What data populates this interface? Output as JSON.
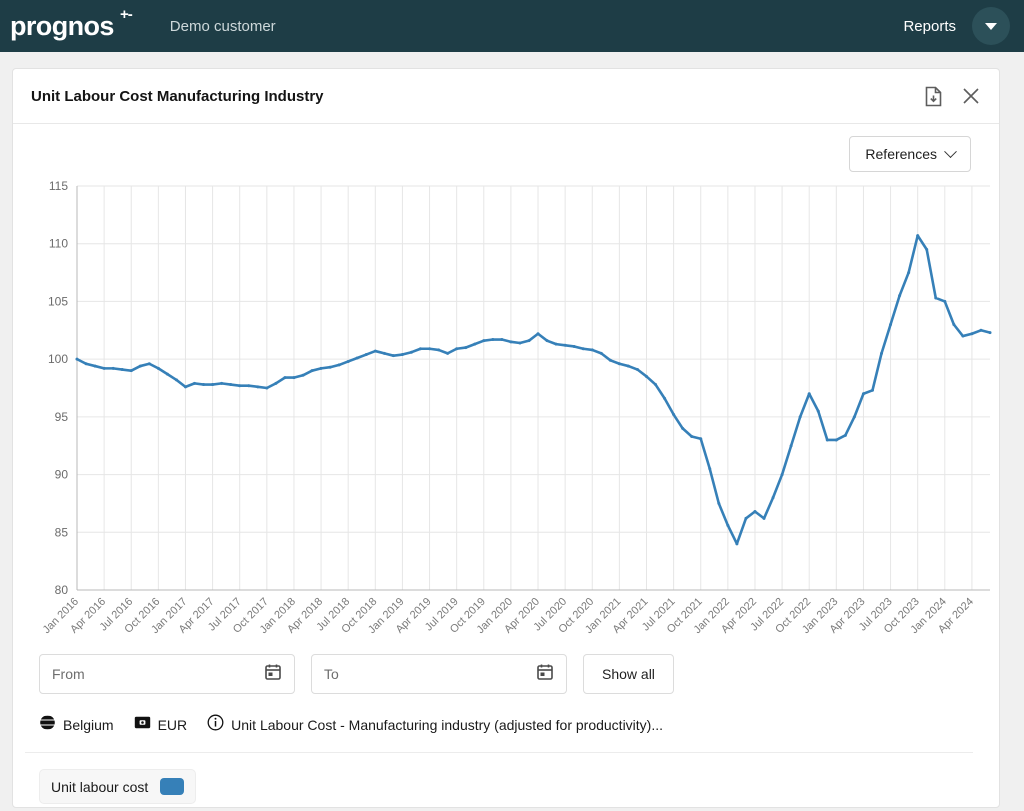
{
  "topbar": {
    "logo_text": "prognos",
    "logo_superscript": "+-",
    "customer": "Demo customer",
    "reports_label": "Reports",
    "avatar_icon": "caret-down-icon",
    "background_color": "#1e3d46"
  },
  "card": {
    "title": "Unit Labour Cost Manufacturing Industry",
    "download_icon": "download-file-icon",
    "close_icon": "close-icon",
    "references_label": "References",
    "references_chevron_icon": "chevron-down-icon"
  },
  "controls": {
    "from_placeholder": "From",
    "from_value": "",
    "to_placeholder": "To",
    "to_value": "",
    "calendar_icon": "calendar-icon",
    "show_all_label": "Show all"
  },
  "meta": {
    "globe_icon": "globe-icon",
    "country": "Belgium",
    "currency_icon": "currency-icon",
    "currency": "EUR",
    "info_icon": "info-icon",
    "description": "Unit Labour Cost - Manufacturing industry (adjusted for productivity)..."
  },
  "legend": {
    "label": "Unit labour cost",
    "color": "#3680b8"
  },
  "chart_data": {
    "type": "line",
    "title": "Unit Labour Cost Manufacturing Industry",
    "xlabel": "",
    "ylabel": "",
    "ylim": [
      80,
      115
    ],
    "yticks": [
      80,
      85,
      90,
      95,
      100,
      105,
      110,
      115
    ],
    "grid": true,
    "legend_position": "bottom-left",
    "line_color": "#3680b8",
    "tick_labels": [
      "Jan 2016",
      "Apr 2016",
      "Jul 2016",
      "Oct 2016",
      "Jan 2017",
      "Apr 2017",
      "Jul 2017",
      "Oct 2017",
      "Jan 2018",
      "Apr 2018",
      "Jul 2018",
      "Oct 2018",
      "Jan 2019",
      "Apr 2019",
      "Jul 2019",
      "Oct 2019",
      "Jan 2020",
      "Apr 2020",
      "Jul 2020",
      "Oct 2020",
      "Jan 2021",
      "Apr 2021",
      "Jul 2021",
      "Oct 2021",
      "Jan 2022",
      "Apr 2022",
      "Jul 2022",
      "Oct 2022",
      "Jan 2023",
      "Apr 2023",
      "Jul 2023",
      "Oct 2023",
      "Jan 2024",
      "Apr 2024"
    ],
    "series": [
      {
        "name": "Unit labour cost",
        "x": [
          "Jan 2016",
          "Feb 2016",
          "Mar 2016",
          "Apr 2016",
          "May 2016",
          "Jun 2016",
          "Jul 2016",
          "Aug 2016",
          "Sep 2016",
          "Oct 2016",
          "Nov 2016",
          "Dec 2016",
          "Jan 2017",
          "Feb 2017",
          "Mar 2017",
          "Apr 2017",
          "May 2017",
          "Jun 2017",
          "Jul 2017",
          "Aug 2017",
          "Sep 2017",
          "Oct 2017",
          "Nov 2017",
          "Dec 2017",
          "Jan 2018",
          "Feb 2018",
          "Mar 2018",
          "Apr 2018",
          "May 2018",
          "Jun 2018",
          "Jul 2018",
          "Aug 2018",
          "Sep 2018",
          "Oct 2018",
          "Nov 2018",
          "Dec 2018",
          "Jan 2019",
          "Feb 2019",
          "Mar 2019",
          "Apr 2019",
          "May 2019",
          "Jun 2019",
          "Jul 2019",
          "Aug 2019",
          "Sep 2019",
          "Oct 2019",
          "Nov 2019",
          "Dec 2019",
          "Jan 2020",
          "Feb 2020",
          "Mar 2020",
          "Apr 2020",
          "May 2020",
          "Jun 2020",
          "Jul 2020",
          "Aug 2020",
          "Sep 2020",
          "Oct 2020",
          "Nov 2020",
          "Dec 2020",
          "Jan 2021",
          "Feb 2021",
          "Mar 2021",
          "Apr 2021",
          "May 2021",
          "Jun 2021",
          "Jul 2021",
          "Aug 2021",
          "Sep 2021",
          "Oct 2021",
          "Nov 2021",
          "Dec 2021",
          "Jan 2022",
          "Feb 2022",
          "Mar 2022",
          "Apr 2022",
          "May 2022",
          "Jun 2022",
          "Jul 2022",
          "Aug 2022",
          "Sep 2022",
          "Oct 2022",
          "Nov 2022",
          "Dec 2022",
          "Jan 2023",
          "Feb 2023",
          "Mar 2023",
          "Apr 2023",
          "May 2023",
          "Jun 2023",
          "Jul 2023",
          "Aug 2023",
          "Sep 2023",
          "Oct 2023",
          "Nov 2023",
          "Dec 2023",
          "Jan 2024",
          "Feb 2024",
          "Mar 2024",
          "Apr 2024",
          "May 2024",
          "Jun 2024"
        ],
        "values": [
          100.0,
          99.6,
          99.4,
          99.2,
          99.2,
          99.1,
          99.0,
          99.4,
          99.6,
          99.2,
          98.7,
          98.2,
          97.6,
          97.9,
          97.8,
          97.8,
          97.9,
          97.8,
          97.7,
          97.7,
          97.6,
          97.5,
          97.9,
          98.4,
          98.4,
          98.6,
          99.0,
          99.2,
          99.3,
          99.5,
          99.8,
          100.1,
          100.4,
          100.7,
          100.5,
          100.3,
          100.4,
          100.6,
          100.9,
          100.9,
          100.8,
          100.5,
          100.9,
          101.0,
          101.3,
          101.6,
          101.7,
          101.7,
          101.5,
          101.4,
          101.6,
          102.2,
          101.6,
          101.3,
          101.2,
          101.1,
          100.9,
          100.8,
          100.5,
          99.9,
          99.6,
          99.4,
          99.1,
          98.5,
          97.8,
          96.6,
          95.2,
          94.0,
          93.3,
          93.1,
          90.5,
          87.5,
          85.6,
          84.0,
          86.2,
          86.8,
          86.2,
          88.0,
          90.0,
          92.5,
          95.0,
          97.0,
          95.5,
          93.0,
          93.0,
          93.4,
          95.0,
          97.0,
          97.3,
          100.5,
          103.0,
          105.5,
          107.5,
          110.7,
          109.5,
          105.3,
          105.0,
          103.0,
          102.0,
          102.2,
          102.5,
          102.3
        ]
      }
    ]
  }
}
